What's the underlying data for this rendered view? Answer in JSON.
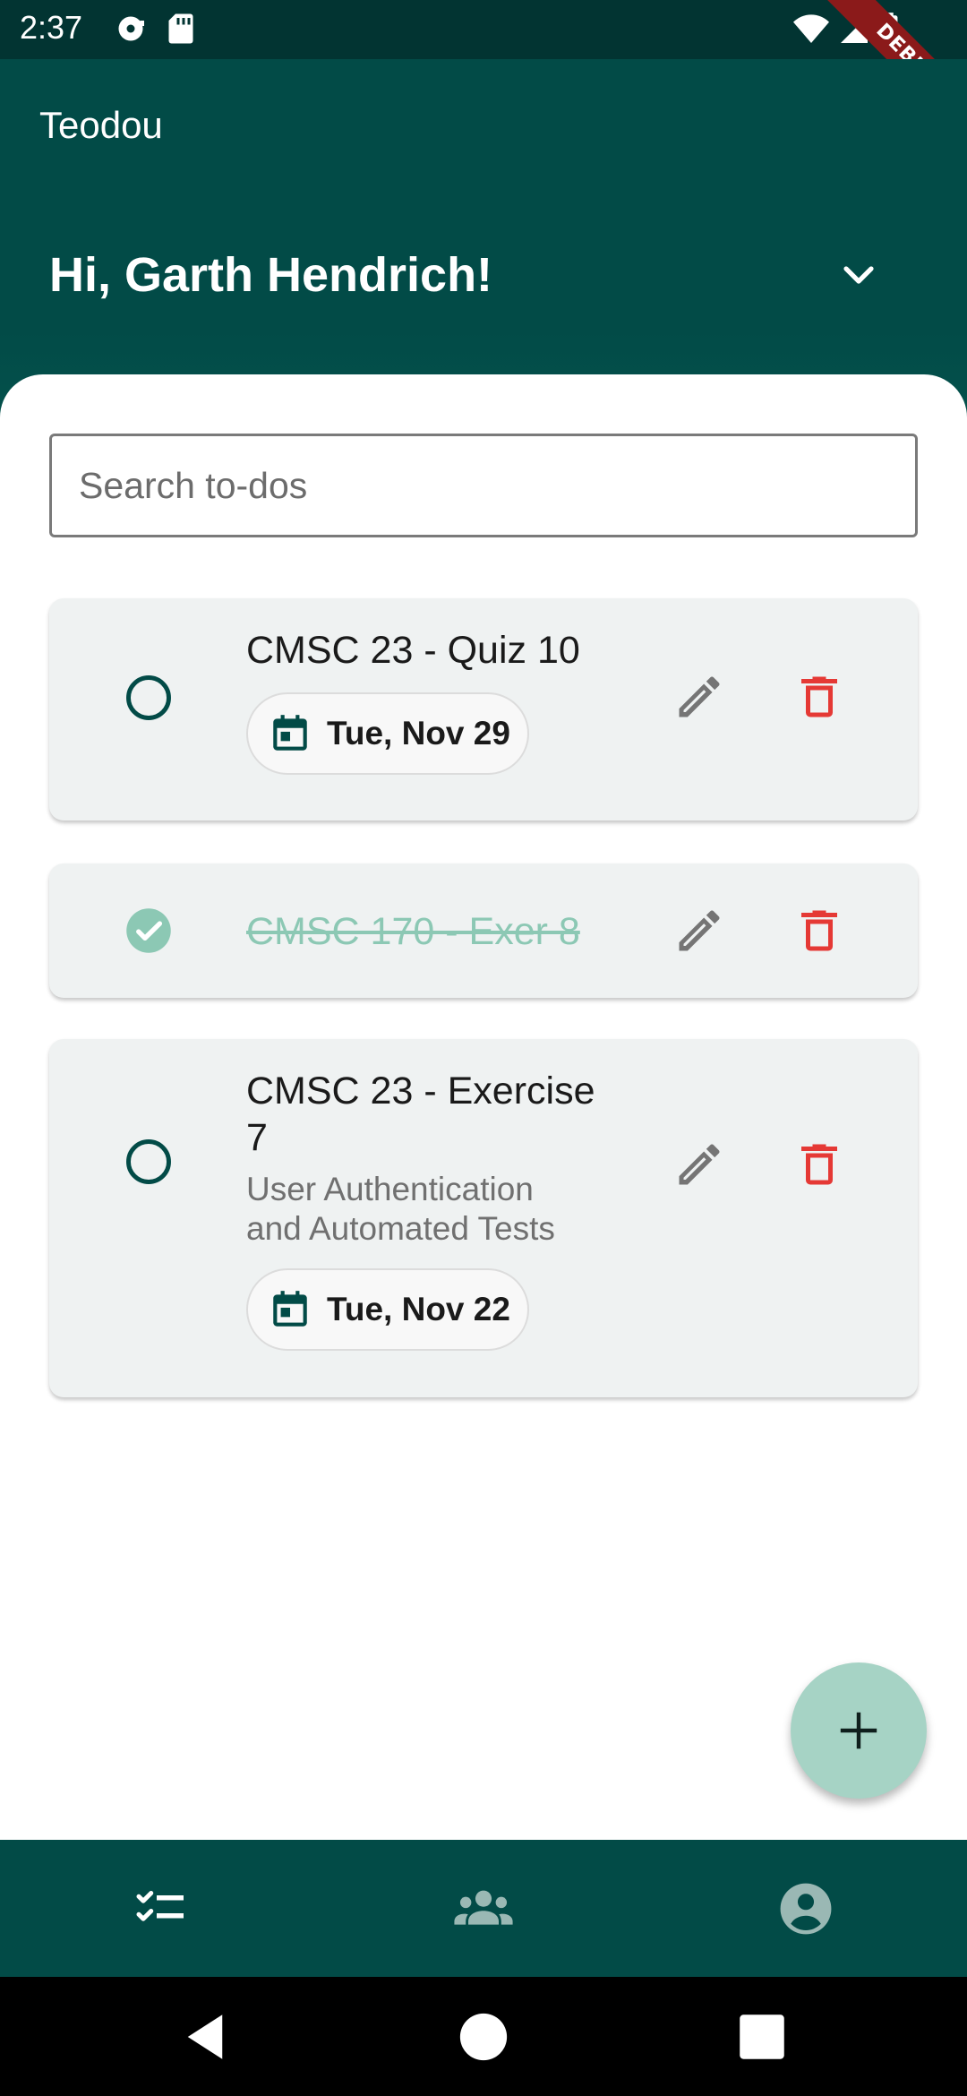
{
  "status_bar": {
    "time": "2:37",
    "icons": [
      "sync-icon",
      "sd-card-icon",
      "wifi-icon",
      "signal-icon",
      "battery-icon"
    ],
    "debug_banner": "DEBUG"
  },
  "app_bar": {
    "title": "Teodou",
    "greeting": "Hi, Garth Hendrich!",
    "colors": {
      "primary": "#024b47",
      "status": "#023432"
    }
  },
  "search": {
    "placeholder": "Search to-dos",
    "value": ""
  },
  "todos": [
    {
      "title": "CMSC 23 - Quiz 10",
      "description": "",
      "date": "Tue, Nov 29",
      "completed": false
    },
    {
      "title": "CMSC 170 - Exer 8",
      "description": "",
      "date": "",
      "completed": true
    },
    {
      "title": "CMSC 23 - Exercise 7",
      "description": "User Authentication and Automated Tests",
      "date": "Tue, Nov 22",
      "completed": false
    }
  ],
  "colors": {
    "delete": "#e53935",
    "edit": "#757575",
    "fab": "#a6d3c5",
    "done": "#8cc8b4"
  },
  "bottom_nav": {
    "items": [
      {
        "icon": "checklist-icon",
        "active": true
      },
      {
        "icon": "groups-icon",
        "active": false
      },
      {
        "icon": "account-circle-icon",
        "active": false
      }
    ]
  },
  "system_nav": [
    "back-icon",
    "home-icon",
    "recents-icon"
  ]
}
